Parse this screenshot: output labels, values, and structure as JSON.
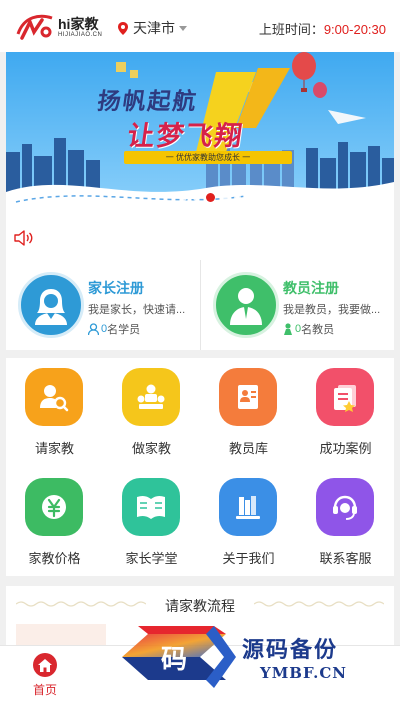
{
  "header": {
    "brand": "hi家教",
    "brand_sub": "HIJIAJIAO.CN",
    "city": "天津市",
    "hours_label": "上班时间：",
    "hours_value": "9:00-20:30"
  },
  "banner": {
    "slogan_1": "扬帆起航",
    "slogan_2": "让梦飞翔",
    "slogan_3": "一 优优家教助您成长 一",
    "slide_count": 5,
    "active_slide": 3
  },
  "notice": {
    "icon": "speaker-icon"
  },
  "register": {
    "parent": {
      "title": "家长注册",
      "desc": "我是家长，快速请...",
      "count": "0",
      "count_suffix": "名学员",
      "icon": "parent-avatar-icon"
    },
    "teacher": {
      "title": "教员注册",
      "desc": "我是教员，我要做...",
      "count": "0",
      "count_suffix": "名教员",
      "icon": "teacher-avatar-icon"
    }
  },
  "menu": [
    {
      "label": "请家教",
      "icon": "find-tutor-icon",
      "color": "#f7a21b"
    },
    {
      "label": "做家教",
      "icon": "be-tutor-icon",
      "color": "#f5c61b"
    },
    {
      "label": "教员库",
      "icon": "tutor-library-icon",
      "color": "#f47c3c"
    },
    {
      "label": "成功案例",
      "icon": "success-case-icon",
      "color": "#f2506a"
    },
    {
      "label": "家教价格",
      "icon": "price-icon",
      "color": "#3dbb63"
    },
    {
      "label": "家长学堂",
      "icon": "parent-school-icon",
      "color": "#2fc39a"
    },
    {
      "label": "关于我们",
      "icon": "about-us-icon",
      "color": "#3b8fe6"
    },
    {
      "label": "联系客服",
      "icon": "customer-service-icon",
      "color": "#8f55e8"
    }
  ],
  "process": {
    "title": "请家教流程"
  },
  "tabbar": {
    "home_label": "首页"
  },
  "watermark": {
    "title": "源码备份",
    "sub": "YMBF.CN",
    "logo_char": "码"
  },
  "colors": {
    "accent": "#e0201e",
    "parent_blue": "#2e9ad6",
    "teacher_green": "#3fbf6a"
  }
}
